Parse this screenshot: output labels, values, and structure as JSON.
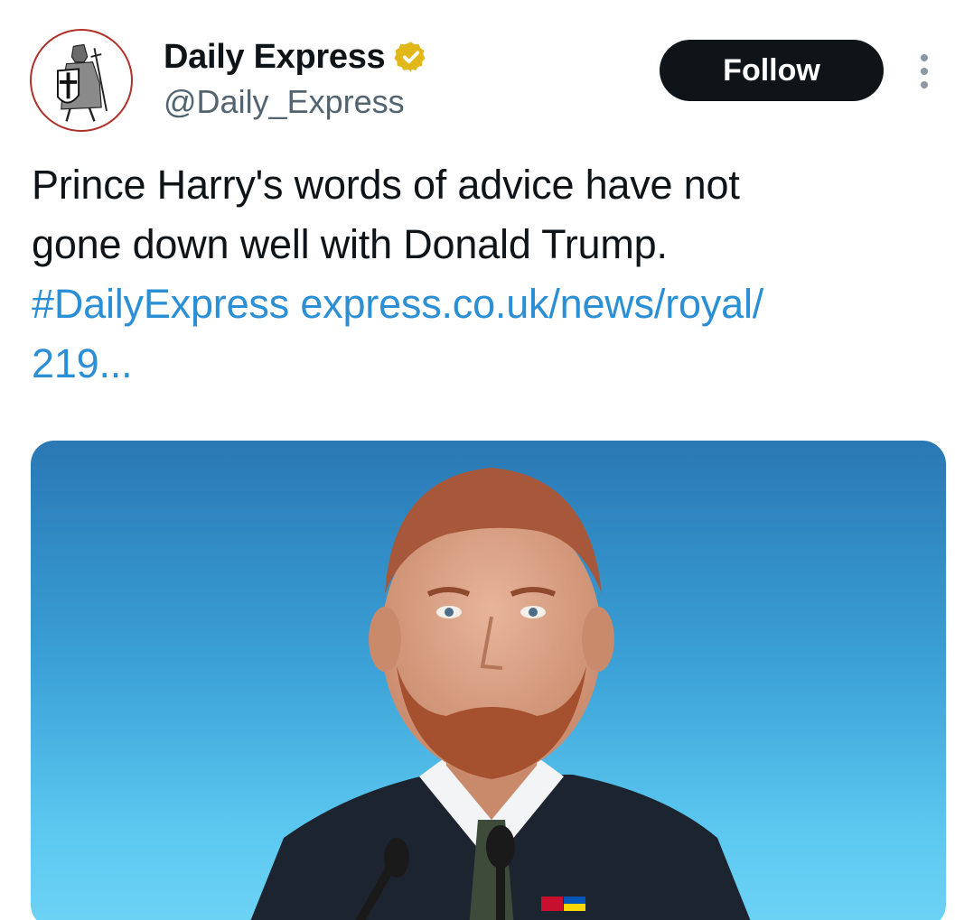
{
  "author": {
    "display_name": "Daily Express",
    "handle": "@Daily_Express",
    "avatar_icon": "crusader-knight-icon",
    "verified_icon": "verified-badge-icon",
    "verified_color": "#e2b719"
  },
  "actions": {
    "follow_label": "Follow",
    "more_icon": "more-vertical-icon"
  },
  "tweet": {
    "text_line1": "Prince Harry's words of advice have not",
    "text_line2": "gone down well with Donald Trump.",
    "hashtag": "#DailyExpress",
    "link": "express.co.uk/news/royal/",
    "link_cont": "219..."
  },
  "colors": {
    "text": "#0f1419",
    "secondary": "#536471",
    "link": "#2b8fd6",
    "button": "#0f1419"
  }
}
